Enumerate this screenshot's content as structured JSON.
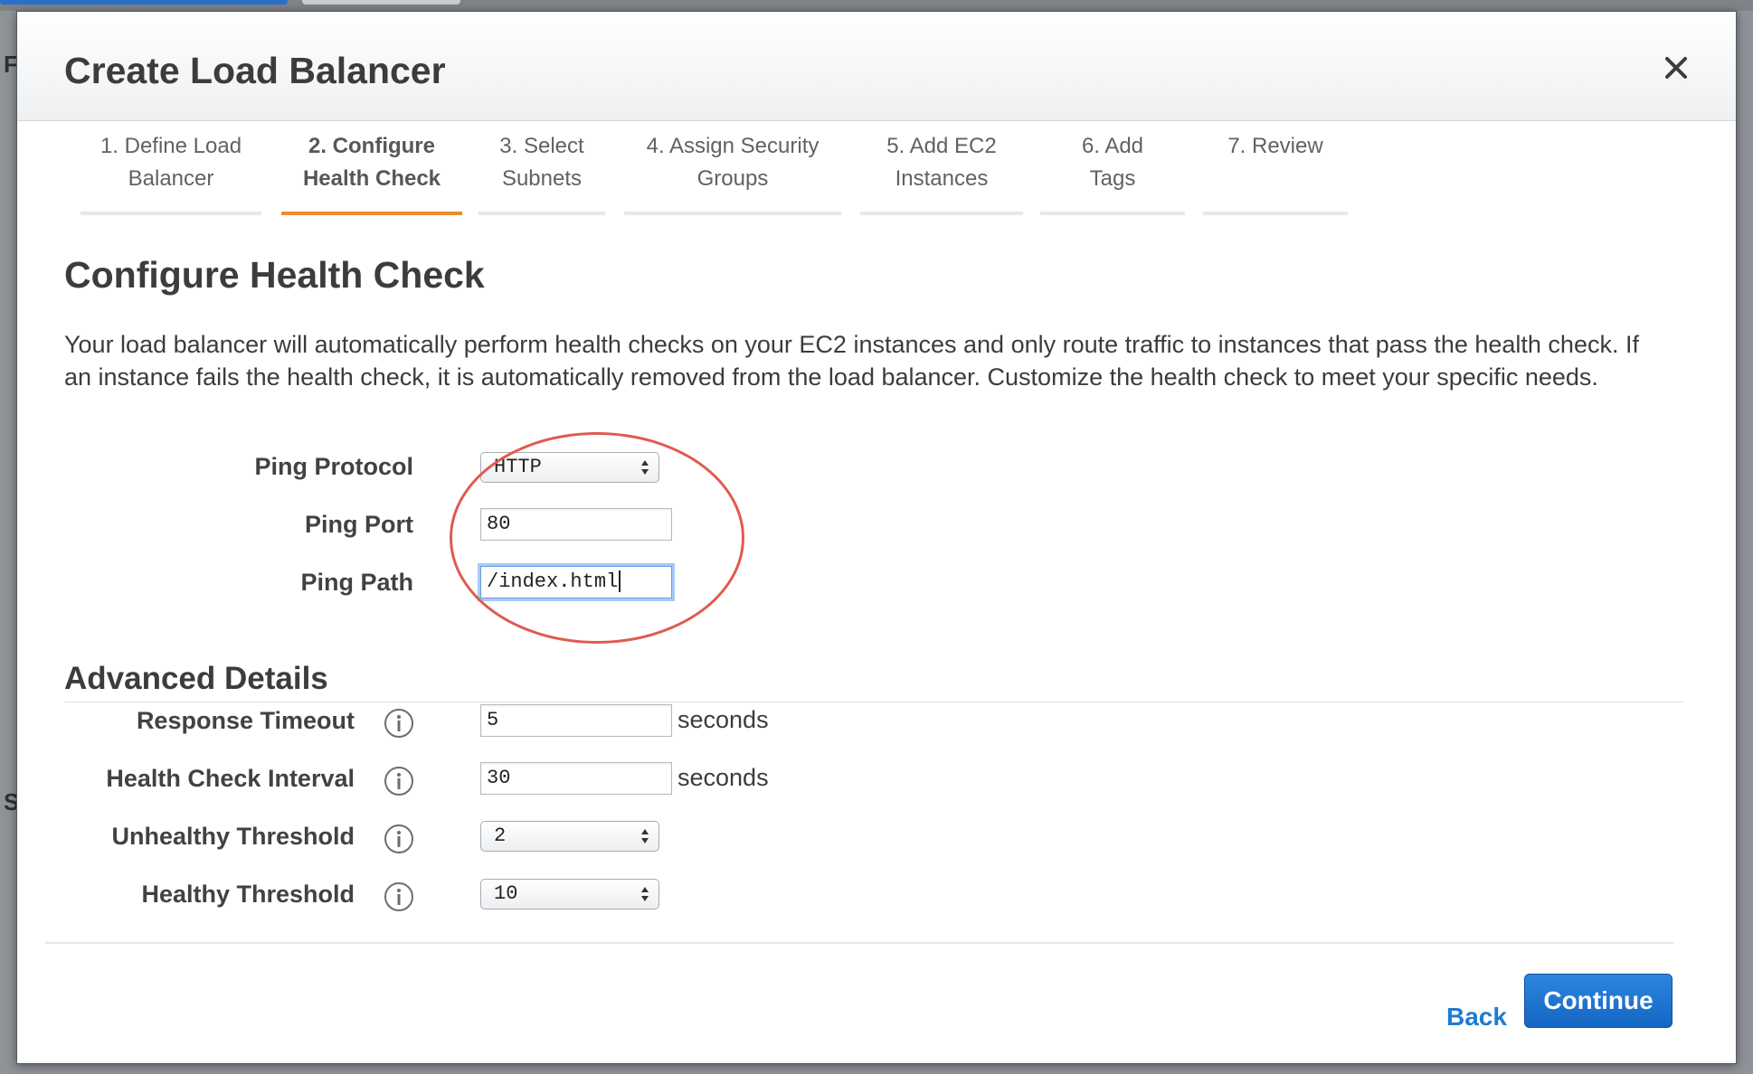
{
  "background": {
    "letters": [
      "F",
      "S"
    ]
  },
  "modal": {
    "title": "Create Load Balancer",
    "close_icon": "close-icon"
  },
  "wizard": {
    "steps": [
      {
        "line1": "1. Define Load",
        "line2": "Balancer",
        "active": false
      },
      {
        "line1": "2. Configure",
        "line2": "Health Check",
        "active": true
      },
      {
        "line1": "3. Select",
        "line2": "Subnets",
        "active": false
      },
      {
        "line1": "4. Assign Security",
        "line2": "Groups",
        "active": false
      },
      {
        "line1": "5. Add EC2",
        "line2": "Instances",
        "active": false
      },
      {
        "line1": "6. Add",
        "line2": "Tags",
        "active": false
      },
      {
        "line1": "7. Review",
        "line2": "",
        "active": false
      }
    ],
    "active_color": "#ee8c2a"
  },
  "section": {
    "title": "Configure Health Check",
    "description": "Your load balancer will automatically perform health checks on your EC2 instances and only route traffic to instances that pass the health check. If an instance fails the health check, it is automatically removed from the load balancer. Customize the health check to meet your specific needs."
  },
  "ping": {
    "protocol_label": "Ping Protocol",
    "protocol_value": "HTTP",
    "port_label": "Ping Port",
    "port_value": "80",
    "path_label": "Ping Path",
    "path_value": "/index.html"
  },
  "advanced": {
    "title": "Advanced Details",
    "response_timeout_label": "Response Timeout",
    "response_timeout_value": "5",
    "response_timeout_unit": "seconds",
    "interval_label": "Health Check Interval",
    "interval_value": "30",
    "interval_unit": "seconds",
    "unhealthy_label": "Unhealthy Threshold",
    "unhealthy_value": "2",
    "healthy_label": "Healthy Threshold",
    "healthy_value": "10",
    "info_icon": "info-icon"
  },
  "footer": {
    "back_label": "Back",
    "continue_label": "Continue"
  },
  "colors": {
    "accent_orange": "#ee8c2a",
    "link_blue": "#1f7bd3",
    "button_blue": "#1f74d2",
    "annotation_red": "#e05a4e"
  }
}
